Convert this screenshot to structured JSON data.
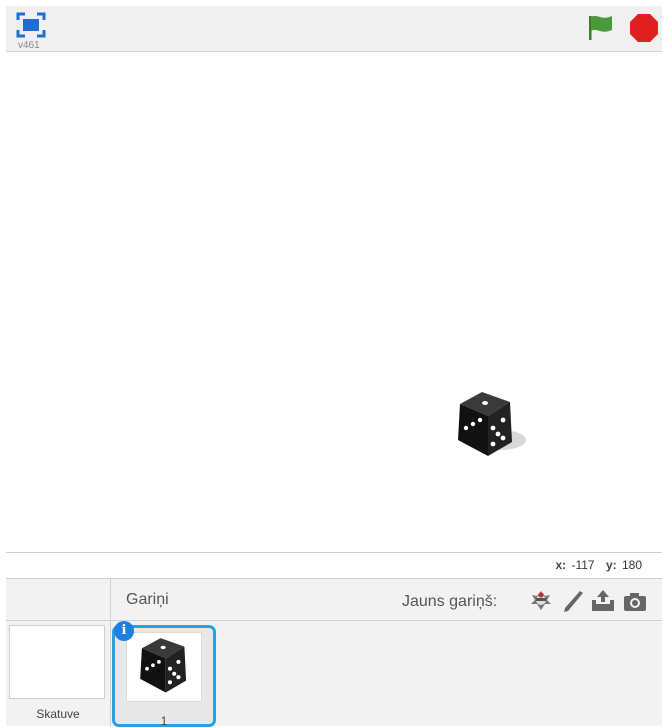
{
  "header": {
    "version": "v461",
    "green_flag_icon": "green-flag-icon",
    "stop_icon": "stop-sign-icon",
    "fullscreen_icon": "fullscreen-icon"
  },
  "stage": {
    "sprite_icon": "dice-sprite",
    "mouse_x_label": "x:",
    "mouse_x_value": "-117",
    "mouse_y_label": "y:",
    "mouse_y_value": "180"
  },
  "sprite_pane": {
    "title": "Gariņi",
    "new_sprite_label": "Jauns gariņš:",
    "stage_label": "Skatuve",
    "sprites": [
      {
        "label": "1",
        "icon": "dice-sprite"
      }
    ],
    "info_badge": "i"
  },
  "colors": {
    "accent_blue": "#29a0e0",
    "flag_green": "#4a9a3a",
    "stop_red": "#e02020"
  }
}
